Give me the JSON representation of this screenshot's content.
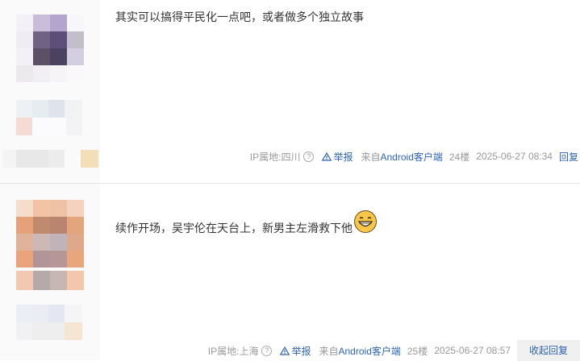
{
  "posts": [
    {
      "text": "其实可以搞得平民化一点吧，或者做多个独立故事",
      "ip": "IP属地:四川",
      "report": "举报",
      "client_prefix": "来自",
      "client_name": "Android客户端",
      "floor": "24楼",
      "time": "2025-06-27 08:34",
      "reply": "回复"
    },
    {
      "text": "续作开场，吴宇伦在天台上，新男主左滑救下他",
      "emoji": "laugh-emoji-icon",
      "ip": "IP属地:上海",
      "report": "举报",
      "client_prefix": "来自",
      "client_name": "Android客户端",
      "floor": "25楼",
      "time": "2025-06-27 08:57",
      "collapse_reply": "收起回复"
    }
  ],
  "colors": {
    "link": "#2d64b3",
    "muted": "#999999",
    "text": "#333333"
  }
}
